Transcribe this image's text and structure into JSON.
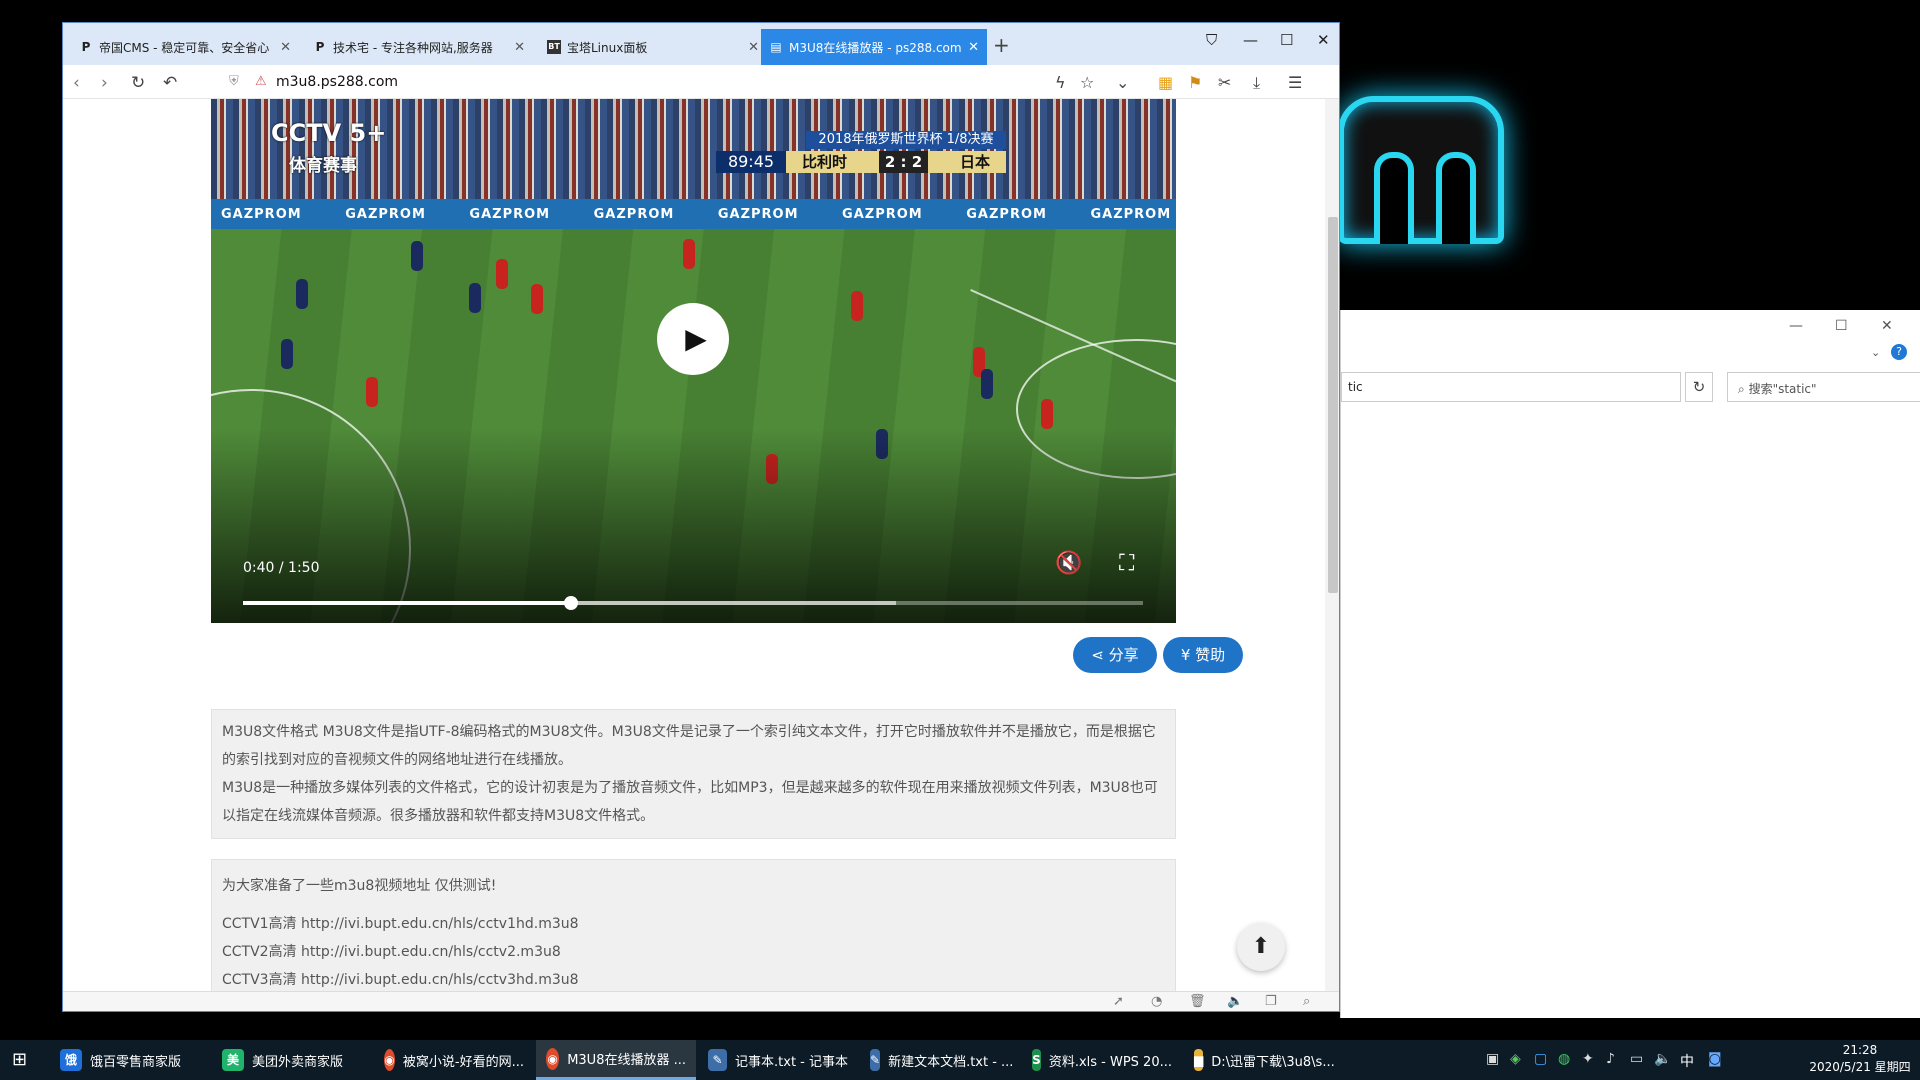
{
  "browser": {
    "tabs": [
      {
        "label": "帝国CMS - 稳定可靠、安全省心",
        "favicon": "P"
      },
      {
        "label": "技术宅 - 专注各种网站,服务器",
        "favicon": "P"
      },
      {
        "label": "宝塔Linux面板",
        "favicon": "BT"
      },
      {
        "label": "M3U8在线播放器 - ps288.com",
        "favicon": "page-icon",
        "active": true
      }
    ],
    "new_tab_label": "+",
    "url": "m3u8.ps288.com"
  },
  "video": {
    "channel_logo": "CCTV 5+",
    "channel_sub": "体育赛事",
    "overlay_title": "2018年俄罗斯世界杯  1/8决赛",
    "match_time": "89:45",
    "team_home": "比利时",
    "score": "2 : 2",
    "team_away": "日本",
    "board_text": "GAZPROM GAZPROM GAZPROM GAZPROM GAZPROM GAZPROM GAZPROM GAZPROM GAZPROM",
    "time_display": "0:40 / 1:50",
    "progress": 0.364,
    "buffered": 0.725
  },
  "actions": {
    "share_label": "分享",
    "donate_label": "¥ 赞助"
  },
  "intro": {
    "p1": "M3U8文件格式 M3U8文件是指UTF-8编码格式的M3U8文件。M3U8文件是记录了一个索引纯文本文件，打开它时播放软件并不是播放它，而是根据它的索引找到对应的音视频文件的网络地址进行在线播放。",
    "p2": "M3U8是一种播放多媒体列表的文件格式，它的设计初衷是为了播放音频文件，比如MP3，但是越来越多的软件现在用来播放视频文件列表，M3U8也可以指定在线流媒体音频源。很多播放器和软件都支持M3U8文件格式。"
  },
  "samples": {
    "heading": "为大家准备了一些m3u8视频地址 仅供测试!",
    "items": [
      "CCTV1高清 http://ivi.bupt.edu.cn/hls/cctv1hd.m3u8",
      "CCTV2高清 http://ivi.bupt.edu.cn/hls/cctv2.m3u8",
      "CCTV3高清 http://ivi.bupt.edu.cn/hls/cctv3hd.m3u8"
    ]
  },
  "explorer": {
    "path_fragment": "tic",
    "search_placeholder": "搜索\"static\""
  },
  "taskbar": {
    "items": [
      {
        "label": "饿百零售商家版",
        "icon": "饿",
        "color": "#1e6fd9"
      },
      {
        "label": "美团外卖商家版",
        "icon": "美",
        "color": "#1fb36b"
      },
      {
        "label": "被窝小说-好看的网...",
        "icon": "◉",
        "color": "#e04b2c"
      },
      {
        "label": "M3U8在线播放器 ...",
        "icon": "◉",
        "color": "#e04b2c",
        "active": true
      },
      {
        "label": "记事本.txt - 记事本",
        "icon": "✎",
        "color": "#3d6ea8"
      },
      {
        "label": "新建文本文档.txt - ...",
        "icon": "✎",
        "color": "#3d6ea8"
      },
      {
        "label": "资料.xls - WPS 20...",
        "icon": "S",
        "color": "#1f8f4d"
      },
      {
        "label": "D:\\迅雷下载\\3u8\\s...",
        "icon": "▆",
        "color": "#e8b33a"
      }
    ],
    "time": "21:28",
    "date": "2020/5/21 星期四",
    "ime": "中"
  }
}
